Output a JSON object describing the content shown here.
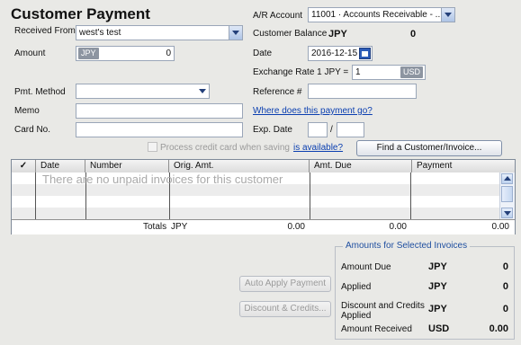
{
  "title": "Customer Payment",
  "received_from": {
    "label": "Received From",
    "value": "west's test"
  },
  "amount": {
    "label": "Amount",
    "currency": "JPY",
    "value": "0"
  },
  "pmt_method": {
    "label": "Pmt. Method",
    "value": ""
  },
  "memo": {
    "label": "Memo",
    "value": ""
  },
  "card_no": {
    "label": "Card No.",
    "value": ""
  },
  "ar_account": {
    "label": "A/R Account",
    "value": "11001 · Accounts Receivable - ..."
  },
  "customer_balance": {
    "label": "Customer Balance",
    "currency": "JPY",
    "value": "0"
  },
  "date": {
    "label": "Date",
    "value": "2016-12-15"
  },
  "exchange_rate": {
    "label": "Exchange Rate 1 JPY =",
    "value": "1",
    "currency": "USD"
  },
  "reference": {
    "label": "Reference #",
    "value": ""
  },
  "where_link": "Where does this payment go?",
  "exp_date": {
    "label": "Exp. Date",
    "month": "",
    "sep": "/",
    "year": ""
  },
  "process_cc": "Process credit card when saving",
  "is_available_link": "is available?",
  "find_button": "Find a Customer/Invoice...",
  "table": {
    "columns": [
      "✓",
      "Date",
      "Number",
      "Orig. Amt.",
      "Amt. Due",
      "Payment"
    ],
    "empty_message": "There are no unpaid invoices for this customer",
    "totals_label": "Totals",
    "totals_currency": "JPY",
    "totals": [
      "0.00",
      "0.00",
      "0.00"
    ]
  },
  "buttons": {
    "auto_apply": "Auto Apply Payment",
    "discount": "Discount & Credits..."
  },
  "amounts": {
    "title": "Amounts for Selected Invoices",
    "rows": [
      {
        "label": "Amount Due",
        "currency": "JPY",
        "value": "0"
      },
      {
        "label": "Applied",
        "currency": "JPY",
        "value": "0"
      },
      {
        "label": "Discount and Credits Applied",
        "currency": "JPY",
        "value": "0"
      },
      {
        "label": "Amount Received",
        "currency": "USD",
        "value": "0.00"
      }
    ]
  }
}
